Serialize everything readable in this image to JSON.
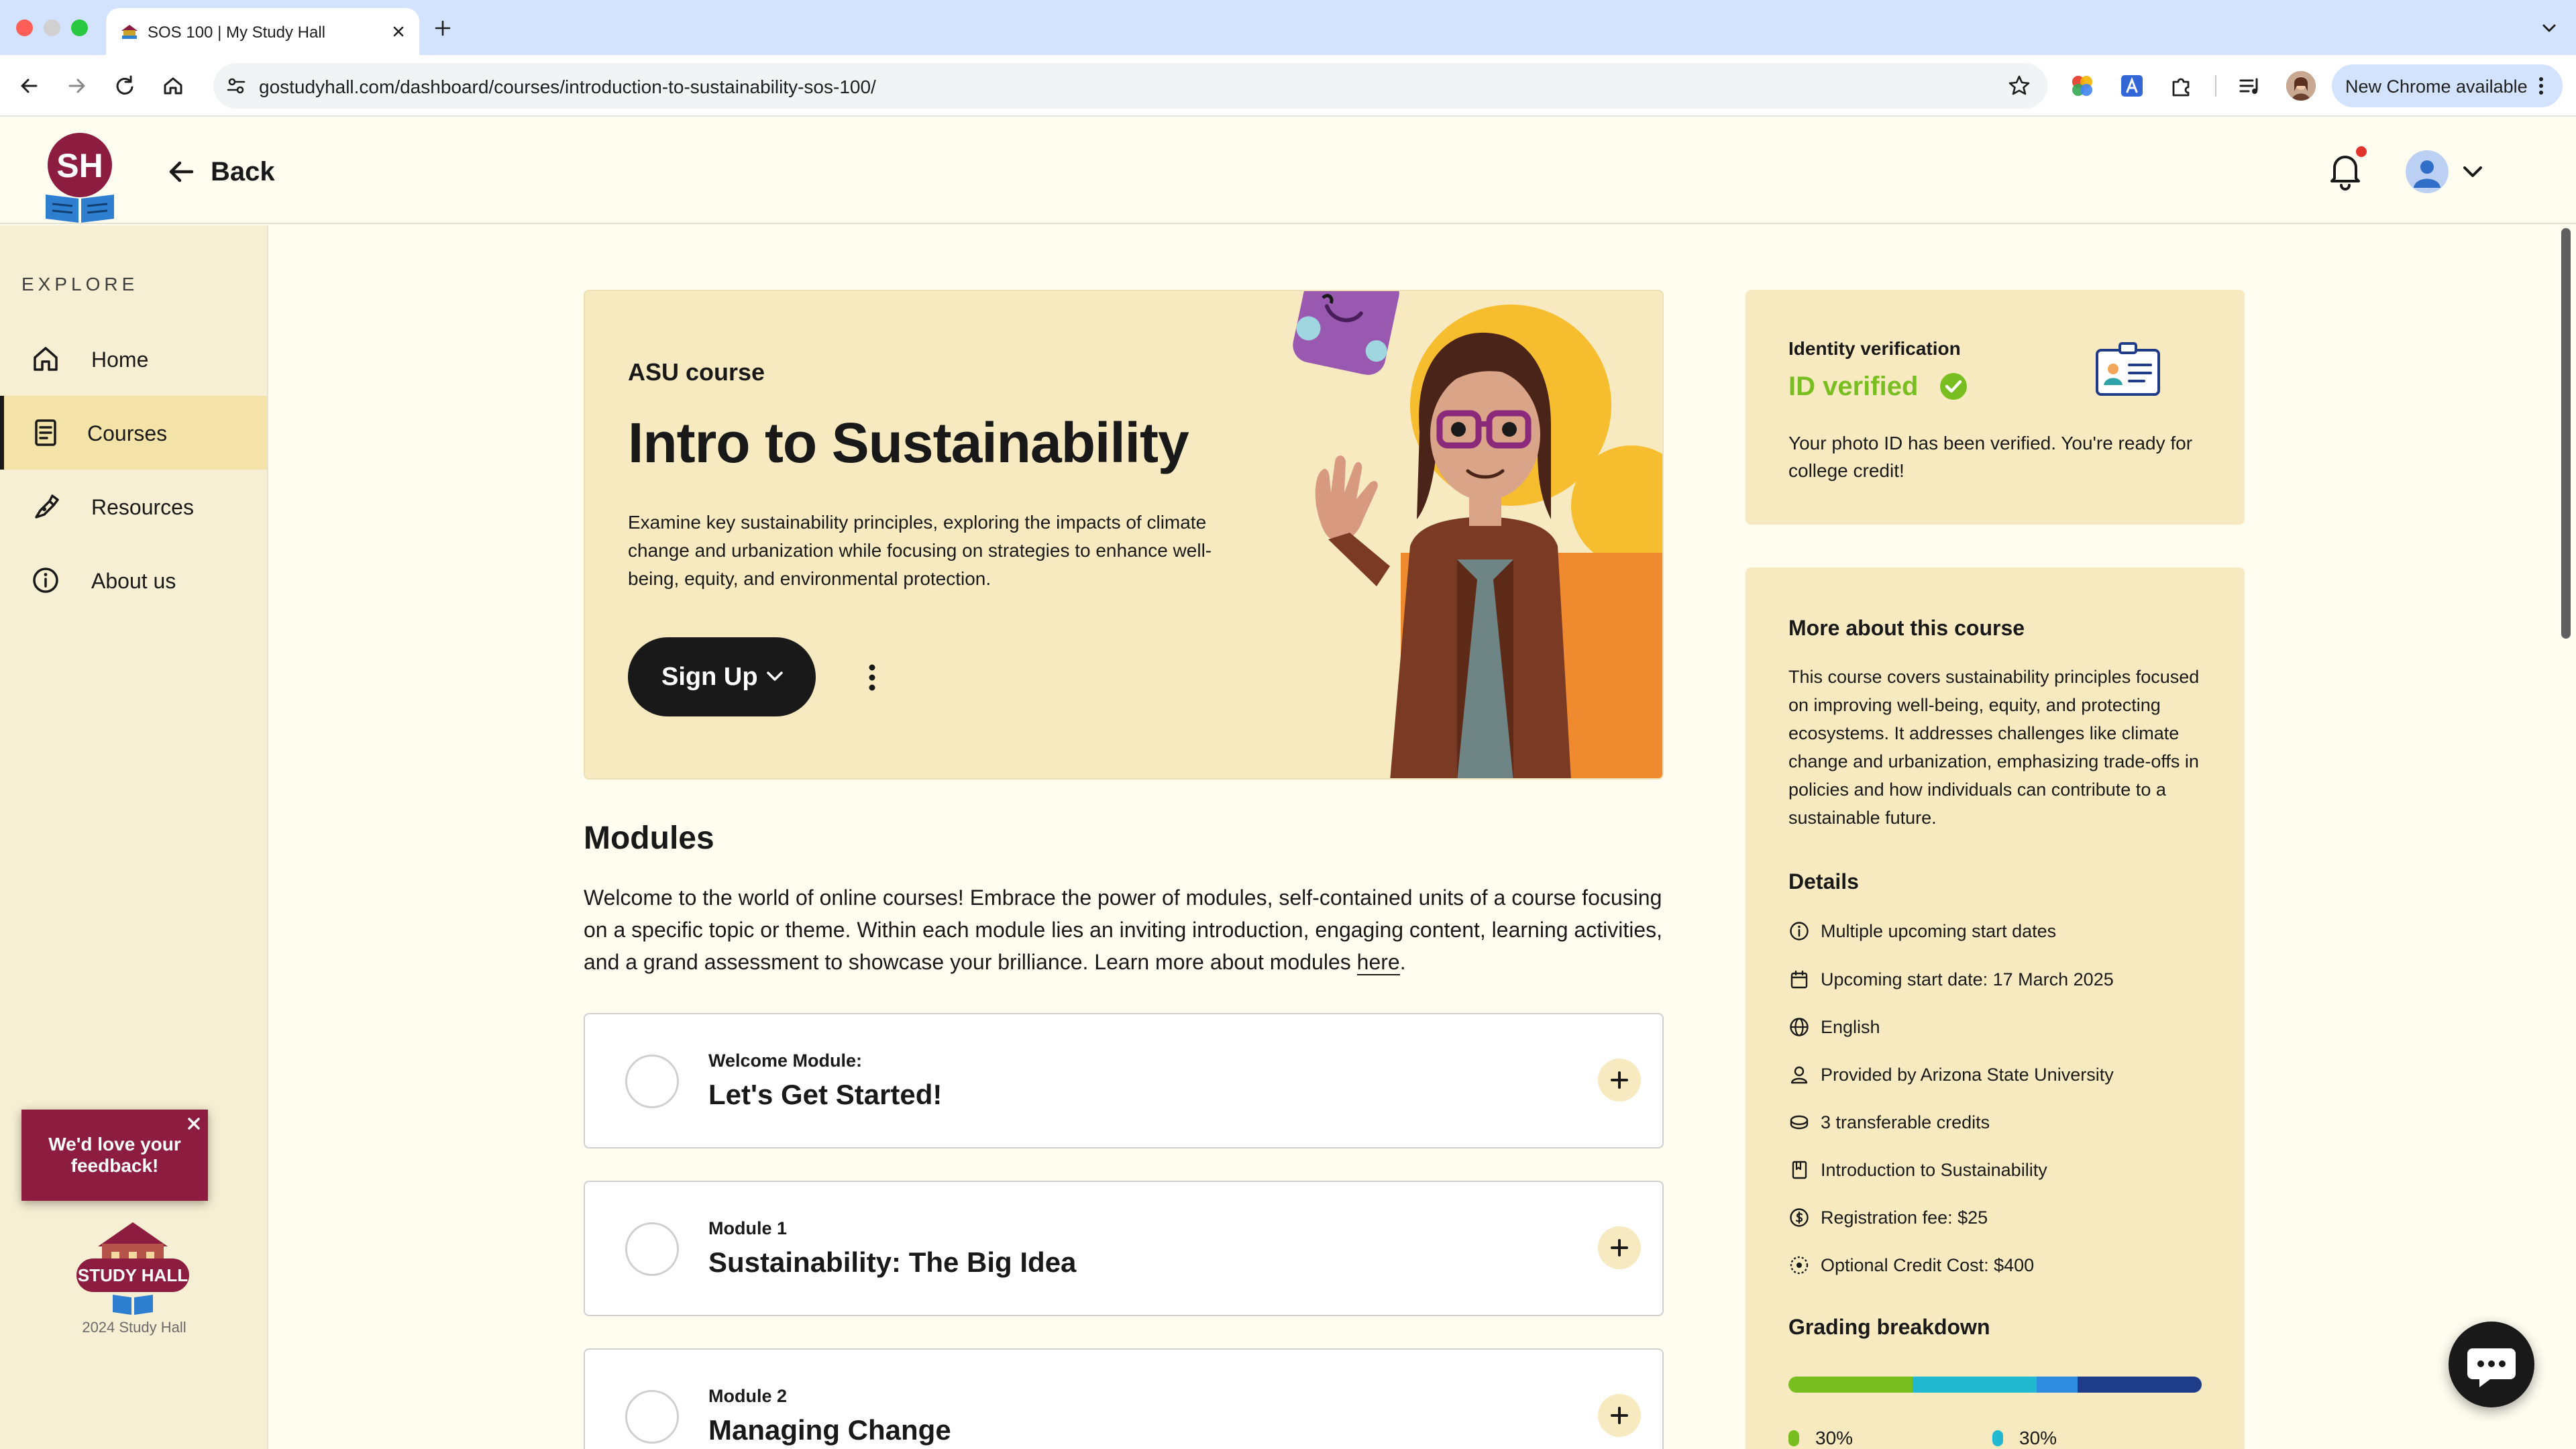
{
  "browser": {
    "tab_title": "SOS 100 | My Study Hall",
    "url": "gostudyhall.com/dashboard/courses/introduction-to-sustainability-sos-100/",
    "update_label": "New Chrome available"
  },
  "header": {
    "logo_text": "SH",
    "back_label": "Back"
  },
  "sidebar": {
    "section_label": "EXPLORE",
    "items": [
      {
        "label": "Home",
        "icon": "home-icon"
      },
      {
        "label": "Courses",
        "icon": "courses-icon",
        "active": true
      },
      {
        "label": "Resources",
        "icon": "resources-icon"
      },
      {
        "label": "About us",
        "icon": "info-icon"
      }
    ],
    "footer_logo_text": "STUDY HALL",
    "copyright": "2024 Study Hall",
    "feedback_label": "We'd love your feedback!"
  },
  "hero": {
    "eyebrow": "ASU course",
    "title": "Intro to Sustainability",
    "description": "Examine key sustainability principles, exploring the impacts of climate change and urbanization while focusing on strategies to enhance well-being, equity, and environmental protection.",
    "signup_label": "Sign Up"
  },
  "modules": {
    "title": "Modules",
    "intro": "Welcome to the world of online courses! Embrace the power of modules, self-contained units of a course focusing on a specific topic or theme. Within each module lies an inviting introduction, engaging content, learning activities, and a grand assessment to showcase your brilliance. Learn more about modules ",
    "intro_link": "here",
    "intro_end": ".",
    "items": [
      {
        "kicker": "Welcome Module:",
        "title": "Let's Get Started!"
      },
      {
        "kicker": "Module 1",
        "title": "Sustainability: The Big Idea"
      },
      {
        "kicker": "Module 2",
        "title": "Managing Change"
      }
    ]
  },
  "identity": {
    "label": "Identity verification",
    "status": "ID verified",
    "description": "Your photo ID has been verified. You're ready for college credit!"
  },
  "course_info": {
    "title": "More about this course",
    "description": "This course covers sustainability principles focused on improving well-being, equity, and protecting ecosystems. It addresses challenges like climate change and urbanization, emphasizing trade-offs in policies and how individuals can contribute to a sustainable future.",
    "details_title": "Details",
    "details": [
      {
        "icon": "info-icon",
        "text": "Multiple upcoming start dates"
      },
      {
        "icon": "calendar-icon",
        "text": "Upcoming start date: 17 March 2025"
      },
      {
        "icon": "globe-icon",
        "text": "English"
      },
      {
        "icon": "person-icon",
        "text": "Provided by Arizona State University"
      },
      {
        "icon": "credits-icon",
        "text": "3 transferable credits"
      },
      {
        "icon": "book-icon",
        "text": "Introduction to Sustainability"
      },
      {
        "icon": "dollar-icon",
        "text": "Registration fee: $25"
      },
      {
        "icon": "badge-icon",
        "text": "Optional Credit Cost: $400"
      }
    ],
    "grading_title": "Grading breakdown",
    "grading": [
      {
        "percent": 30,
        "label": "30%",
        "color": "#78be20"
      },
      {
        "percent": 30,
        "label": "30%",
        "color": "#22b8cf"
      },
      {
        "percent": 10,
        "color": "#2f8ce0"
      },
      {
        "percent": 30,
        "color": "#1f3c88"
      }
    ]
  },
  "colors": {
    "accent_maroon": "#8c1d40",
    "cream": "#fffcf0",
    "card": "#f7eac0",
    "verified_green": "#78be20"
  }
}
